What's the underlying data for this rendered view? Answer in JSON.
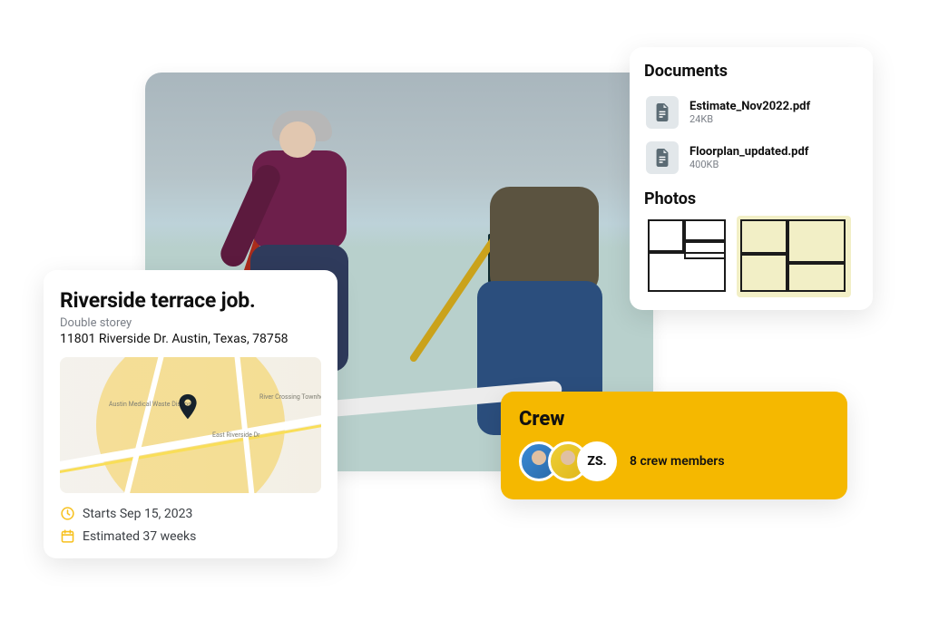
{
  "job": {
    "title": "Riverside terrace job.",
    "subtitle": "Double storey",
    "address": "11801 Riverside Dr. Austin, Texas, 78758",
    "start_label": "Starts Sep 15, 2023",
    "estimate_label": "Estimated 37 weeks",
    "map_labels": [
      "Austin Medical Waste Disposal",
      "East Riverside Dr",
      "River Crossing Townhomes"
    ]
  },
  "documents": {
    "heading": "Documents",
    "files": [
      {
        "name": "Estimate_Nov2022.pdf",
        "size": "24KB"
      },
      {
        "name": "Floorplan_updated.pdf",
        "size": "400KB"
      }
    ],
    "photos_heading": "Photos"
  },
  "crew": {
    "heading": "Crew",
    "initials_avatar": "ZS.",
    "count_label": "8 crew members"
  }
}
